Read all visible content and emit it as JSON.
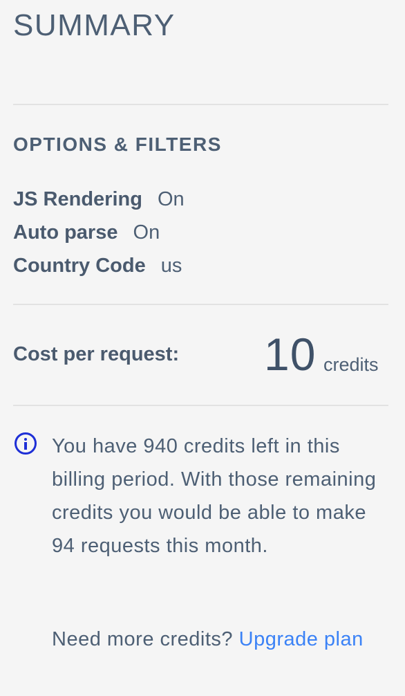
{
  "summary": {
    "title": "SUMMARY"
  },
  "options": {
    "heading": "OPTIONS & FILTERS",
    "items": [
      {
        "label": "JS Rendering",
        "value": "On"
      },
      {
        "label": "Auto parse",
        "value": "On"
      },
      {
        "label": "Country Code",
        "value": "us"
      }
    ]
  },
  "cost": {
    "label": "Cost per request:",
    "value": "10",
    "unit": "credits"
  },
  "info": {
    "icon": "info-icon",
    "message": "You have 940 credits left in this billing period. With those remaining credits you would be able to make 94 requests this month.",
    "upgrade_prompt": "Need more credits?",
    "upgrade_link": "Upgrade plan"
  },
  "colors": {
    "text": "#4a5a6e",
    "link": "#3b82f6",
    "info_icon": "#1e2fd6",
    "background": "#f5f5f5",
    "divider": "#e2e2e2"
  }
}
